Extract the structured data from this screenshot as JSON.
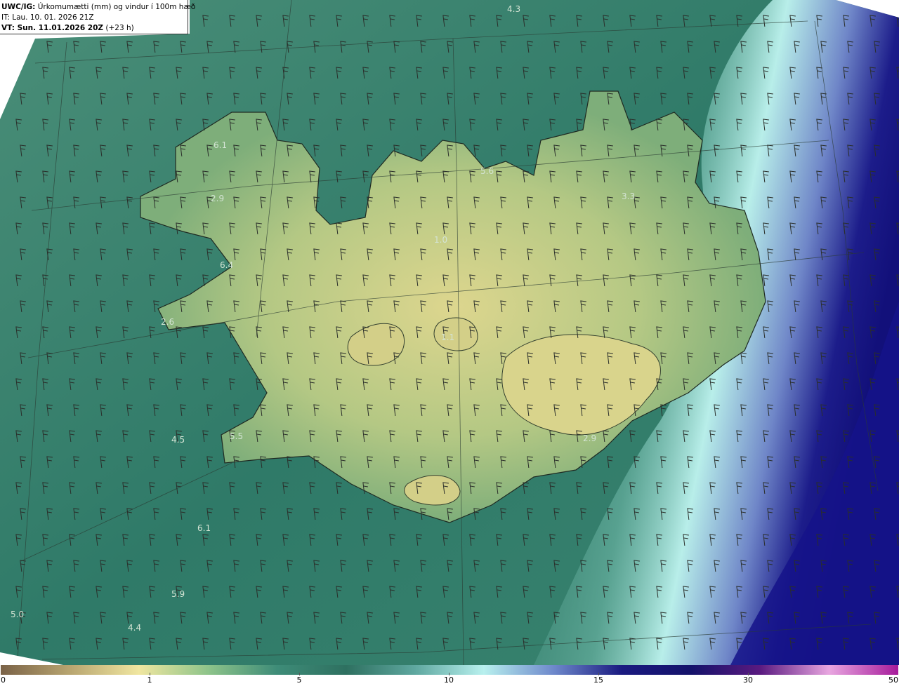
{
  "header": {
    "model_label": "UWC/IG:",
    "title": "Úrkomumætti (mm) og vindur í 100m hæð",
    "init_time": "IT: Lau. 10. 01. 2026 21Z",
    "valid_label": "VT: Sun. 11.01.2026 20Z",
    "lead_time": "(+23 h)"
  },
  "map_values": [
    "4.3",
    "6.1",
    "5.6",
    "2.9",
    "3.3",
    "6.4",
    "1.0",
    "2.6",
    "1.1",
    "4.5",
    "5.5",
    "2.9",
    "6.1",
    "5.9",
    "5.0",
    "4.4"
  ],
  "colorbar": {
    "ticks": [
      "0",
      "1",
      "5",
      "10",
      "15",
      "30",
      "50"
    ],
    "colors": [
      "#7a6247",
      "#b8a570",
      "#f0e6a0",
      "#8ec48a",
      "#3e8c78",
      "#2e7060",
      "#5fa8a0",
      "#b8f0ee",
      "#6f8acc",
      "#1a1a80",
      "#14126a",
      "#5a1a80",
      "#e8a6e0",
      "#a61a9a"
    ]
  },
  "map_colors": {
    "sea": "#2f7a68",
    "land_high": "#d8d48a",
    "land_mid": "#9ab878",
    "precip_light": "#a8e8e6",
    "precip_heavy": "#141486"
  }
}
